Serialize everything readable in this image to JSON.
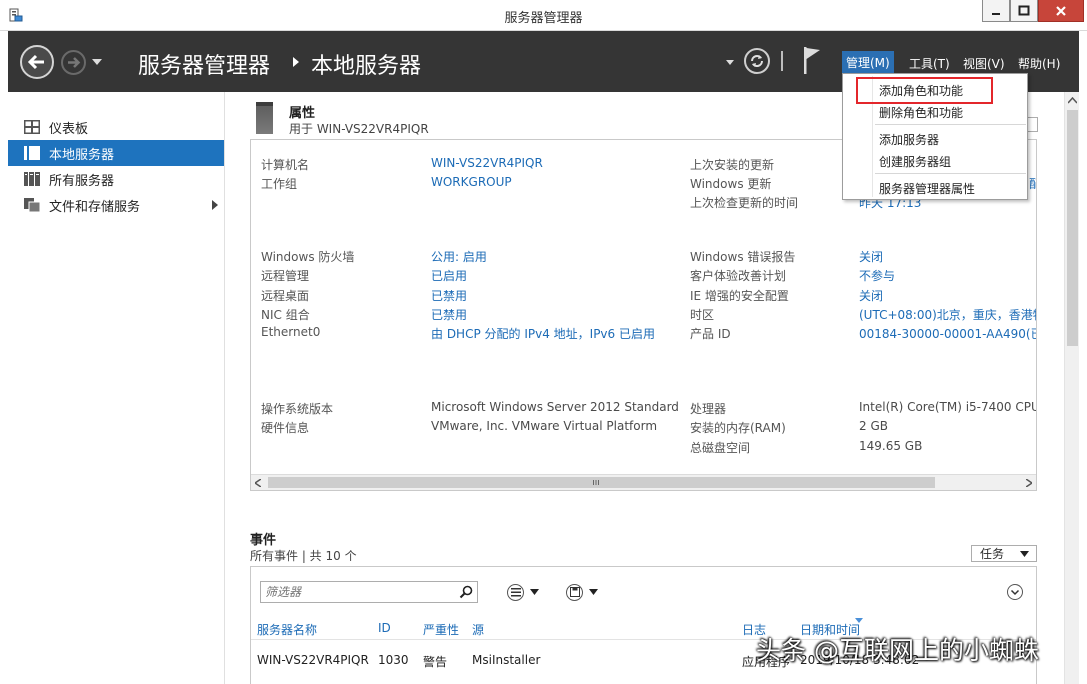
{
  "window": {
    "title": "服务器管理器"
  },
  "header": {
    "breadcrumb_root": "服务器管理器",
    "breadcrumb_current": "本地服务器",
    "menus": {
      "manage": "管理(M)",
      "tools": "工具(T)",
      "view": "视图(V)",
      "help": "帮助(H)"
    }
  },
  "sidebar": {
    "items": [
      {
        "label": "仪表板",
        "icon": "dashboard-icon"
      },
      {
        "label": "本地服务器",
        "icon": "server-icon",
        "active": true
      },
      {
        "label": "所有服务器",
        "icon": "servers-icon"
      },
      {
        "label": "文件和存储服务",
        "icon": "storage-icon"
      }
    ]
  },
  "properties": {
    "title": "属性",
    "subtitle": "用于 WIN-VS22VR4PIQR",
    "left": [
      {
        "label": "计算机名",
        "value": "WIN-VS22VR4PIQR"
      },
      {
        "label": "工作组",
        "value": "WORKGROUP"
      },
      {
        "label": "Windows 防火墙",
        "value": "公用: 启用"
      },
      {
        "label": "远程管理",
        "value": "已启用"
      },
      {
        "label": "远程桌面",
        "value": "已禁用"
      },
      {
        "label": "NIC 组合",
        "value": "已禁用"
      },
      {
        "label": "Ethernet0",
        "value": "由 DHCP 分配的 IPv4 地址，IPv6 已启用"
      },
      {
        "label": "操作系统版本",
        "value": "Microsoft Windows Server 2012 Standard"
      },
      {
        "label": "硬件信息",
        "value": "VMware, Inc. VMware Virtual Platform"
      }
    ],
    "right": [
      {
        "label": "上次安装的更新",
        "value": ""
      },
      {
        "label": "Windows 更新",
        "value": "配"
      },
      {
        "label": "上次检查更新的时间",
        "value": "昨天 17:13"
      },
      {
        "label": "Windows 错误报告",
        "value": "关闭"
      },
      {
        "label": "客户体验改善计划",
        "value": "不参与"
      },
      {
        "label": "IE 增强的安全配置",
        "value": "关闭"
      },
      {
        "label": "时区",
        "value": "(UTC+08:00)北京，重庆，香港特"
      },
      {
        "label": "产品 ID",
        "value": "00184-30000-00001-AA490(已"
      },
      {
        "label": "处理器",
        "value": "Intel(R) Core(TM) i5-7400 CPU"
      },
      {
        "label": "安装的内存(RAM)",
        "value": "2 GB"
      },
      {
        "label": "总磁盘空间",
        "value": "149.65 GB"
      }
    ]
  },
  "events": {
    "title": "事件",
    "subtitle": "所有事件 | 共 10 个",
    "tasks_label": "任务",
    "filter_placeholder": "筛选器",
    "columns": [
      "服务器名称",
      "ID",
      "严重性",
      "源",
      "日志",
      "日期和时间"
    ],
    "rows": [
      {
        "server": "WIN-VS22VR4PIQR",
        "id": "1030",
        "severity": "警告",
        "source": "MsiInstaller",
        "log": "应用程序",
        "datetime": "2019/10/18 3:48:02"
      }
    ]
  },
  "manage_menu": {
    "items": [
      "添加角色和功能",
      "删除角色和功能",
      "添加服务器",
      "创建服务器组",
      "服务器管理器属性"
    ],
    "highlighted": "添加角色和功能"
  },
  "watermark": {
    "text": "头条 @互联网上的小蜘蛛"
  },
  "colors": {
    "accent": "#1e73be",
    "header_bg": "#353535",
    "link": "#1c6bb6",
    "highlight_box": "#e3262b"
  }
}
